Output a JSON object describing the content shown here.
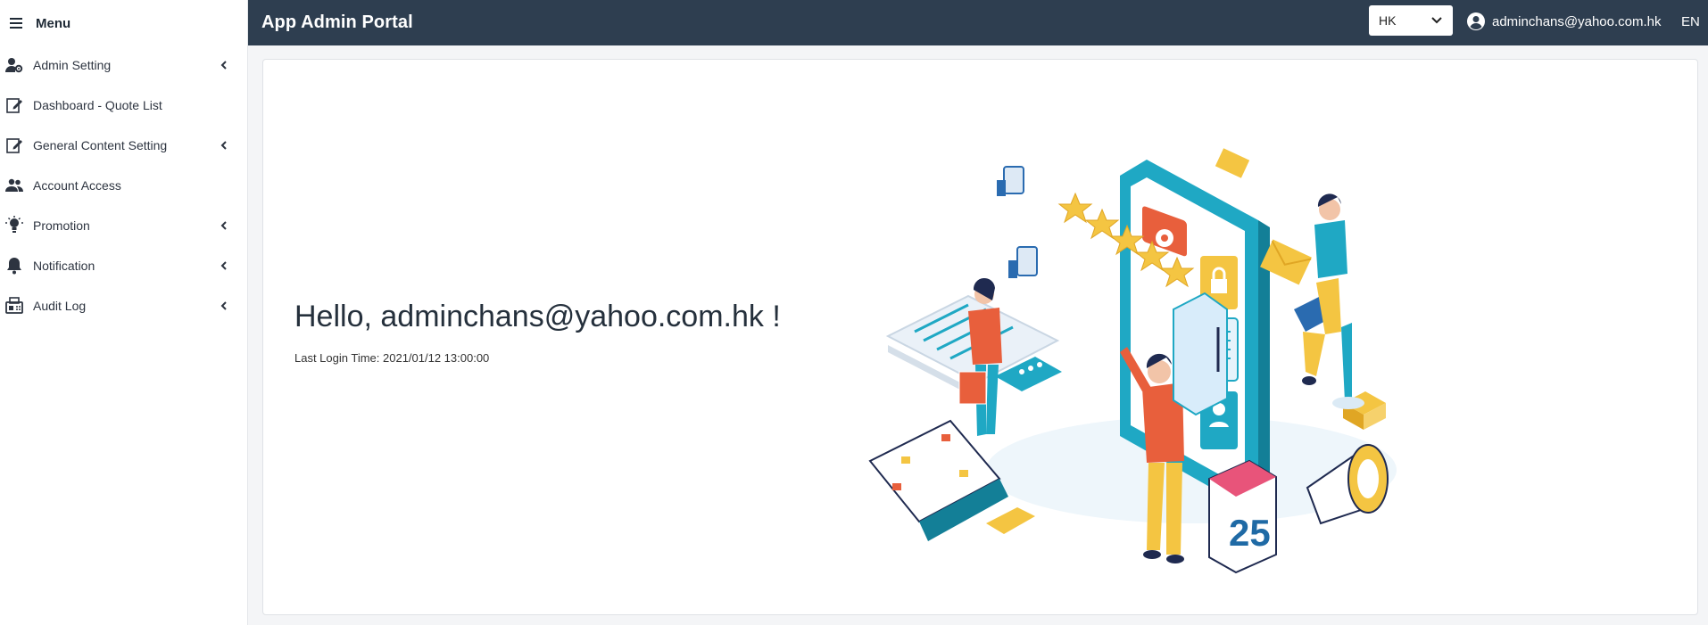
{
  "menu": {
    "title": "Menu"
  },
  "sidebar": {
    "items": [
      {
        "label": "Admin Setting",
        "icon": "user-gear-icon",
        "has_submenu": true
      },
      {
        "label": "Dashboard - Quote List",
        "icon": "edit-icon",
        "has_submenu": false
      },
      {
        "label": "General Content Setting",
        "icon": "edit-icon",
        "has_submenu": true
      },
      {
        "label": "Account Access",
        "icon": "users-icon",
        "has_submenu": false
      },
      {
        "label": "Promotion",
        "icon": "lightbulb-icon",
        "has_submenu": true
      },
      {
        "label": "Notification",
        "icon": "bell-icon",
        "has_submenu": true
      },
      {
        "label": "Audit Log",
        "icon": "fax-icon",
        "has_submenu": true
      }
    ]
  },
  "header": {
    "title": "App Admin Portal",
    "region_select": "HK",
    "user_email": "adminchans@yahoo.com.hk",
    "language": "EN"
  },
  "main": {
    "greeting": "Hello, adminchans@yahoo.com.hk !",
    "last_login": "Last Login Time: 2021/01/12 13:00:00",
    "calendar_day": "25"
  },
  "colors": {
    "header_bg": "#2e3e50",
    "accent_teal": "#1fa8c4",
    "accent_orange": "#e85f3c",
    "accent_yellow": "#f4c542"
  }
}
